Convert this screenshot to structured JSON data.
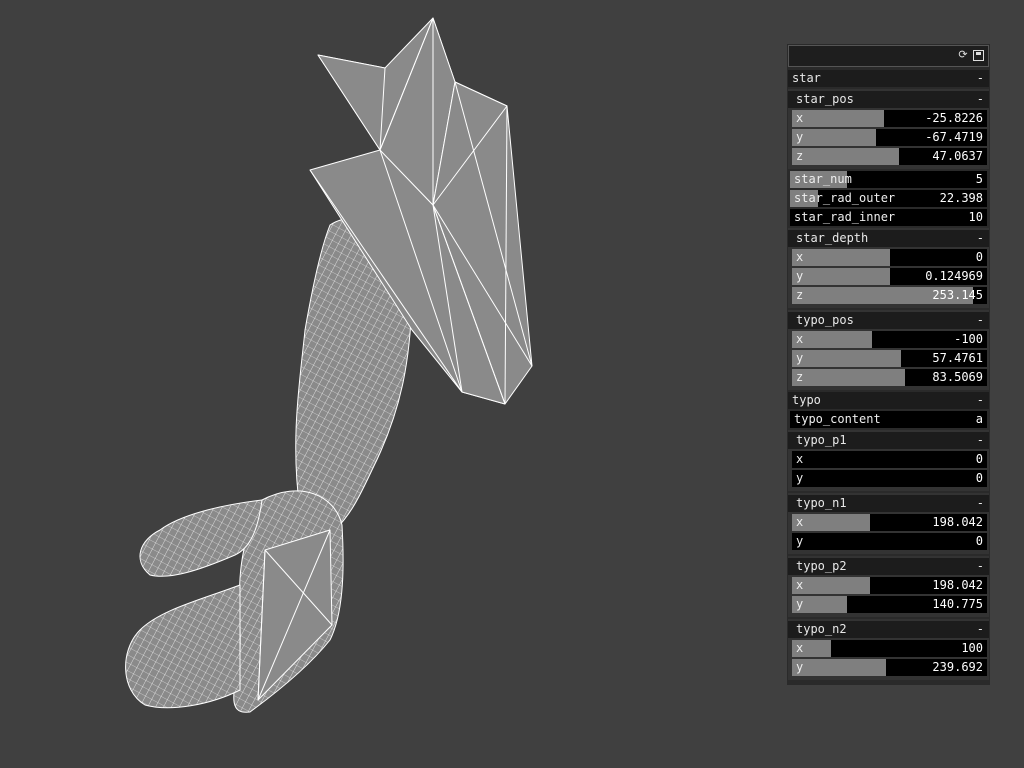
{
  "viewport": {
    "background": "#404040",
    "mesh_fill": "#8a8a8a",
    "mesh_stroke": "#ffffff"
  },
  "panel": {
    "title": "",
    "icons": [
      "refresh-icon",
      "save-icon"
    ],
    "groups": {
      "star": {
        "label": "star",
        "toggle": "-",
        "star_pos": {
          "label": "star_pos",
          "toggle": "-",
          "x": {
            "label": "x",
            "value": "-25.8226",
            "fill": 0.47
          },
          "y": {
            "label": "y",
            "value": "-67.4719",
            "fill": 0.43
          },
          "z": {
            "label": "z",
            "value": "47.0637",
            "fill": 0.55
          }
        },
        "star_num": {
          "label": "star_num",
          "value": "5",
          "fill": 0.29
        },
        "star_rad_outer": {
          "label": "star_rad_outer",
          "value": "22.398",
          "fill": 0.14
        },
        "star_rad_inner": {
          "label": "star_rad_inner",
          "value": "10",
          "fill": 0.0
        },
        "star_depth": {
          "label": "star_depth",
          "toggle": "-",
          "x": {
            "label": "x",
            "value": "0",
            "fill": 0.5
          },
          "y": {
            "label": "y",
            "value": "0.124969",
            "fill": 0.5
          },
          "z": {
            "label": "z",
            "value": "253.145",
            "fill": 0.93
          }
        },
        "typo_pos": {
          "label": "typo_pos",
          "toggle": "-",
          "x": {
            "label": "x",
            "value": "-100",
            "fill": 0.41
          },
          "y": {
            "label": "y",
            "value": "57.4761",
            "fill": 0.56
          },
          "z": {
            "label": "z",
            "value": "83.5069",
            "fill": 0.58
          }
        }
      },
      "typo": {
        "label": "typo",
        "toggle": "-",
        "typo_content": {
          "label": "typo_content",
          "value": "a"
        },
        "typo_p1": {
          "label": "typo_p1",
          "toggle": "-",
          "x": {
            "label": "x",
            "value": "0",
            "fill": 0.0
          },
          "y": {
            "label": "y",
            "value": "0",
            "fill": 0.0
          }
        },
        "typo_n1": {
          "label": "typo_n1",
          "toggle": "-",
          "x": {
            "label": "x",
            "value": "198.042",
            "fill": 0.4
          },
          "y": {
            "label": "y",
            "value": "0",
            "fill": 0.0
          }
        },
        "typo_p2": {
          "label": "typo_p2",
          "toggle": "-",
          "x": {
            "label": "x",
            "value": "198.042",
            "fill": 0.4
          },
          "y": {
            "label": "y",
            "value": "140.775",
            "fill": 0.28
          }
        },
        "typo_n2": {
          "label": "typo_n2",
          "toggle": "-",
          "x": {
            "label": "x",
            "value": "100",
            "fill": 0.2
          },
          "y": {
            "label": "y",
            "value": "239.692",
            "fill": 0.48
          }
        }
      }
    }
  }
}
